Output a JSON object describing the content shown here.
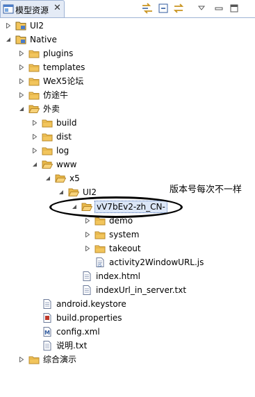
{
  "tab": {
    "title": "模型资源",
    "close": "✕"
  },
  "toolbar": {
    "buttons": [
      "sync-icon",
      "collapse-all-icon",
      "link-with-editor-icon",
      "view-menu-icon",
      "minimize-icon",
      "maximize-icon"
    ]
  },
  "tree": {
    "ui2_root": "UI2",
    "native": "Native",
    "plugins": "plugins",
    "templates": "templates",
    "wex5_forum": "WeX5论坛",
    "fangtuniu": "仿途牛",
    "waimai": "外卖",
    "build": "build",
    "dist": "dist",
    "log": "log",
    "www": "www",
    "x5": "x5",
    "ui2_inner": "UI2",
    "version_folder": "vV7bEv2-zh_CN-",
    "demo": "demo",
    "system": "system",
    "takeout": "takeout",
    "activity_js": "activity2WindowURL.js",
    "index_html": "index.html",
    "index_url_txt": "indexUrl_in_server.txt",
    "keystore": "android.keystore",
    "build_properties": "build.properties",
    "config_xml": "config.xml",
    "readme_txt": "说明.txt",
    "demo_app": "综合演示"
  },
  "annotation": {
    "text": "版本号每次不一样"
  },
  "colors": {
    "folder": "#e8b84a",
    "selection": "#dbe6f7",
    "tab_bg": "#e4ebf6"
  }
}
